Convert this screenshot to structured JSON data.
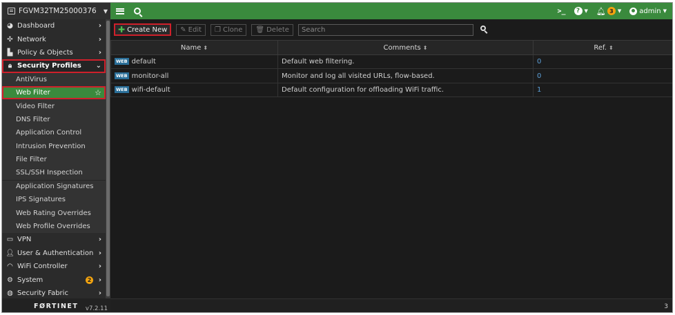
{
  "device": {
    "name": "FGVM32TM25000376"
  },
  "topbar": {
    "terminal": ">_",
    "help": "?",
    "notifications": "3",
    "user": "admin"
  },
  "sidebar": {
    "items": [
      {
        "label": "Dashboard",
        "icon": "dashboard-icon"
      },
      {
        "label": "Network",
        "icon": "network-icon"
      },
      {
        "label": "Policy & Objects",
        "icon": "policy-icon"
      },
      {
        "label": "Security Profiles",
        "icon": "lock-icon",
        "expanded": true
      },
      {
        "label": "VPN",
        "icon": "vpn-icon"
      },
      {
        "label": "User & Authentication",
        "icon": "user-icon"
      },
      {
        "label": "WiFi Controller",
        "icon": "wifi-icon"
      },
      {
        "label": "System",
        "icon": "gear-icon",
        "badge": "2"
      },
      {
        "label": "Security Fabric",
        "icon": "fabric-icon"
      }
    ],
    "security_sub": [
      "AntiVirus",
      "Web Filter",
      "Video Filter",
      "DNS Filter",
      "Application Control",
      "Intrusion Prevention",
      "File Filter",
      "SSL/SSH Inspection",
      "Application Signatures",
      "IPS Signatures",
      "Web Rating Overrides",
      "Web Profile Overrides"
    ],
    "active_sub": "Web Filter",
    "logo": "FØRTINET",
    "version": "v7.2.11"
  },
  "toolbar": {
    "create_new": "Create New",
    "edit": "Edit",
    "clone": "Clone",
    "delete": "Delete",
    "search_placeholder": "Search"
  },
  "table": {
    "columns": [
      "Name",
      "Comments",
      "Ref."
    ],
    "tag": "WEB",
    "rows": [
      {
        "name": "default",
        "comments": "Default web filtering.",
        "ref": "0"
      },
      {
        "name": "monitor-all",
        "comments": "Monitor and log all visited URLs, flow-based.",
        "ref": "0"
      },
      {
        "name": "wifi-default",
        "comments": "Default configuration for offloading WiFi traffic.",
        "ref": "1"
      }
    ]
  },
  "footer": {
    "count": "3"
  },
  "colors": {
    "accent_green": "#3a8a3d",
    "highlight_red": "#d0202b",
    "badge_orange": "#f2a30f",
    "web_tag": "#2a6f99"
  }
}
